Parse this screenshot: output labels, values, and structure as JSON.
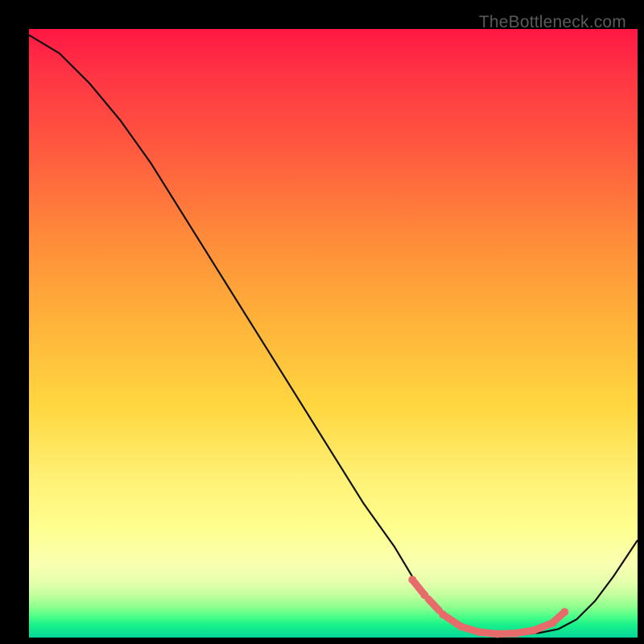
{
  "watermark": "TheBottleneck.com",
  "chart_data": {
    "type": "line",
    "title": "",
    "xlabel": "",
    "ylabel": "",
    "xlim": [
      0,
      100
    ],
    "ylim": [
      0,
      100
    ],
    "gradient_colors": {
      "top": "#ff1744",
      "mid_upper": "#ff8a3a",
      "mid": "#fff176",
      "mid_lower": "#c2ff9e",
      "bottom": "#07d69a"
    },
    "series": [
      {
        "name": "bottleneck-curve",
        "x": [
          0,
          5,
          10,
          15,
          20,
          25,
          30,
          35,
          40,
          45,
          50,
          55,
          60,
          63,
          66,
          69,
          72,
          75,
          78,
          81,
          84,
          87,
          90,
          93,
          96,
          100
        ],
        "y": [
          99,
          96,
          91,
          85,
          78,
          70,
          62,
          54,
          46,
          38,
          30,
          22,
          15,
          10,
          6,
          3,
          1.4,
          0.8,
          0.5,
          0.5,
          0.8,
          1.4,
          3,
          6,
          10,
          16
        ]
      }
    ],
    "highlight_markers": {
      "name": "optimal-range",
      "kind": "points+segments",
      "color": "#e86b6b",
      "x": [
        63,
        65,
        68,
        71,
        74,
        77,
        80,
        83,
        86,
        88
      ],
      "y": [
        9.5,
        7.0,
        3.8,
        1.8,
        0.9,
        0.6,
        0.7,
        1.2,
        2.4,
        4.2
      ]
    }
  }
}
